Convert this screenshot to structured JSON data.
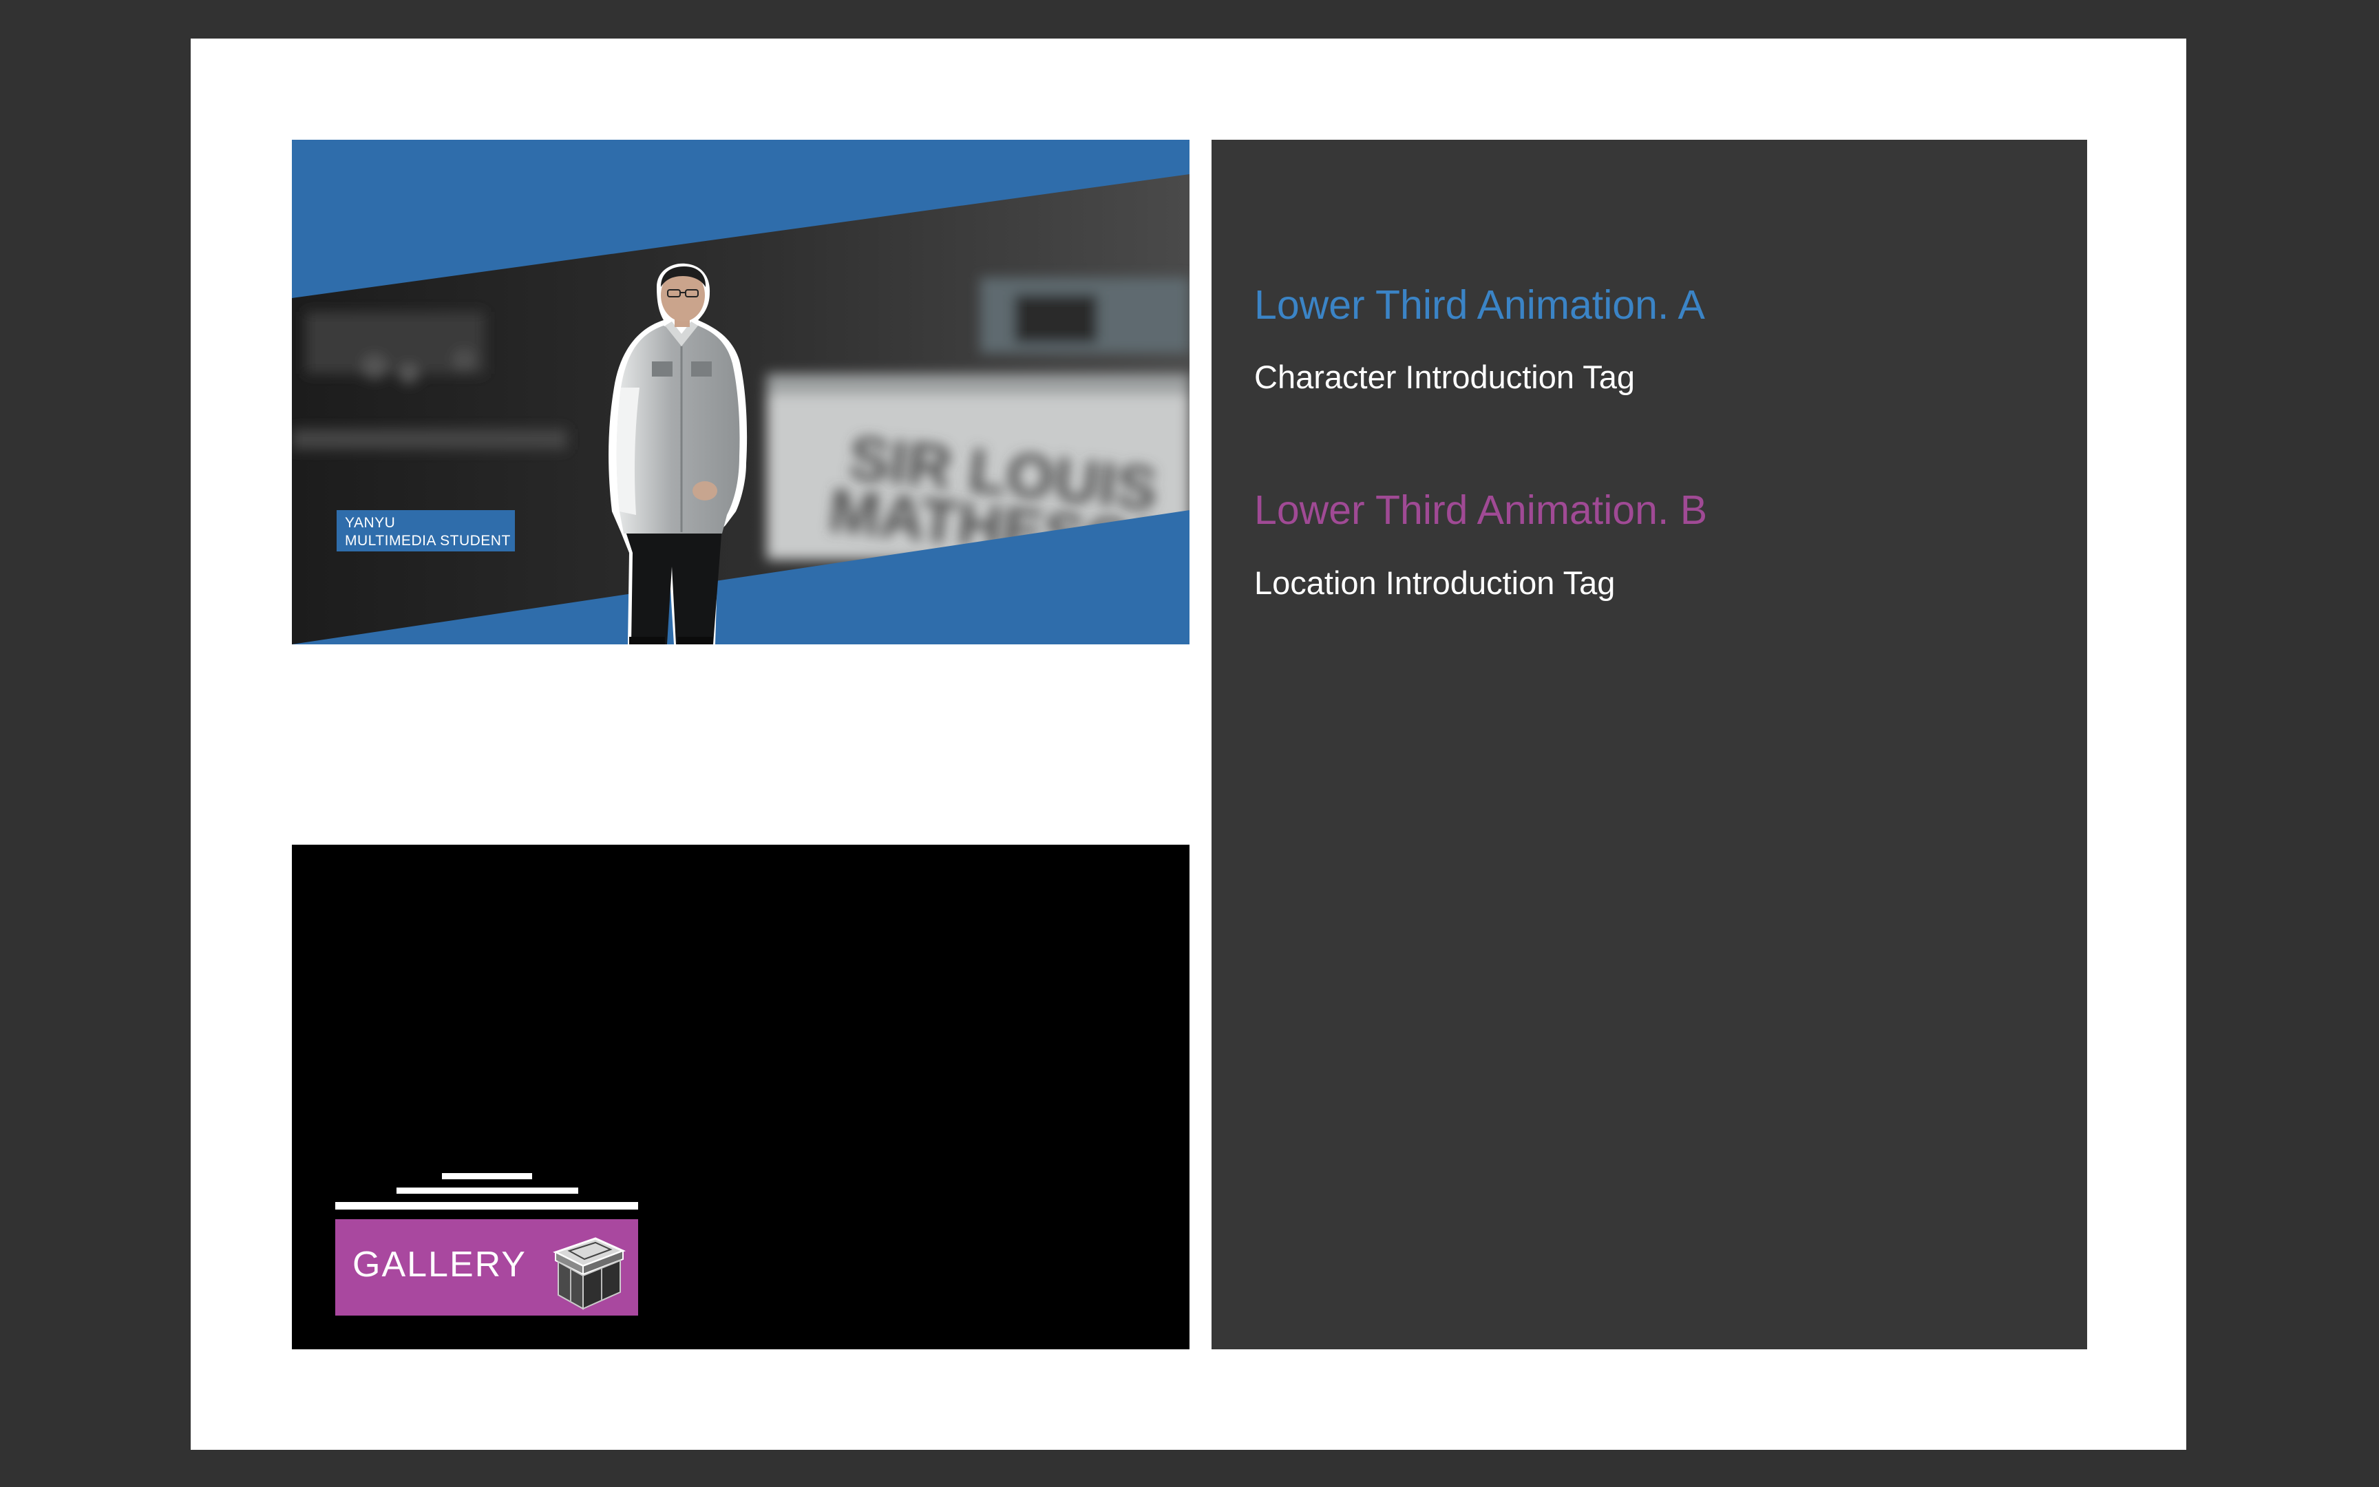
{
  "colors": {
    "app_background": "#323232",
    "canvas": "#ffffff",
    "panel": "#373737",
    "accent_a": "#2f6dab",
    "accent_b": "#a9489f",
    "heading_a": "#3b84c6",
    "heading_b": "#a04a95"
  },
  "preview_a": {
    "name_tag": {
      "line1": "YANYU",
      "line2": "MULTIMEDIA STUDENT"
    },
    "background_sign": "SIR LOUIS MATHESON",
    "person_icon": "person-cutout"
  },
  "preview_b": {
    "location_tag": {
      "label": "GALLERY",
      "icon": "display-case-icon"
    }
  },
  "info": {
    "item_a": {
      "heading": "Lower Third Animation. A",
      "subtitle": "Character Introduction Tag"
    },
    "item_b": {
      "heading": "Lower Third Animation. B",
      "subtitle": "Location Introduction Tag"
    }
  }
}
